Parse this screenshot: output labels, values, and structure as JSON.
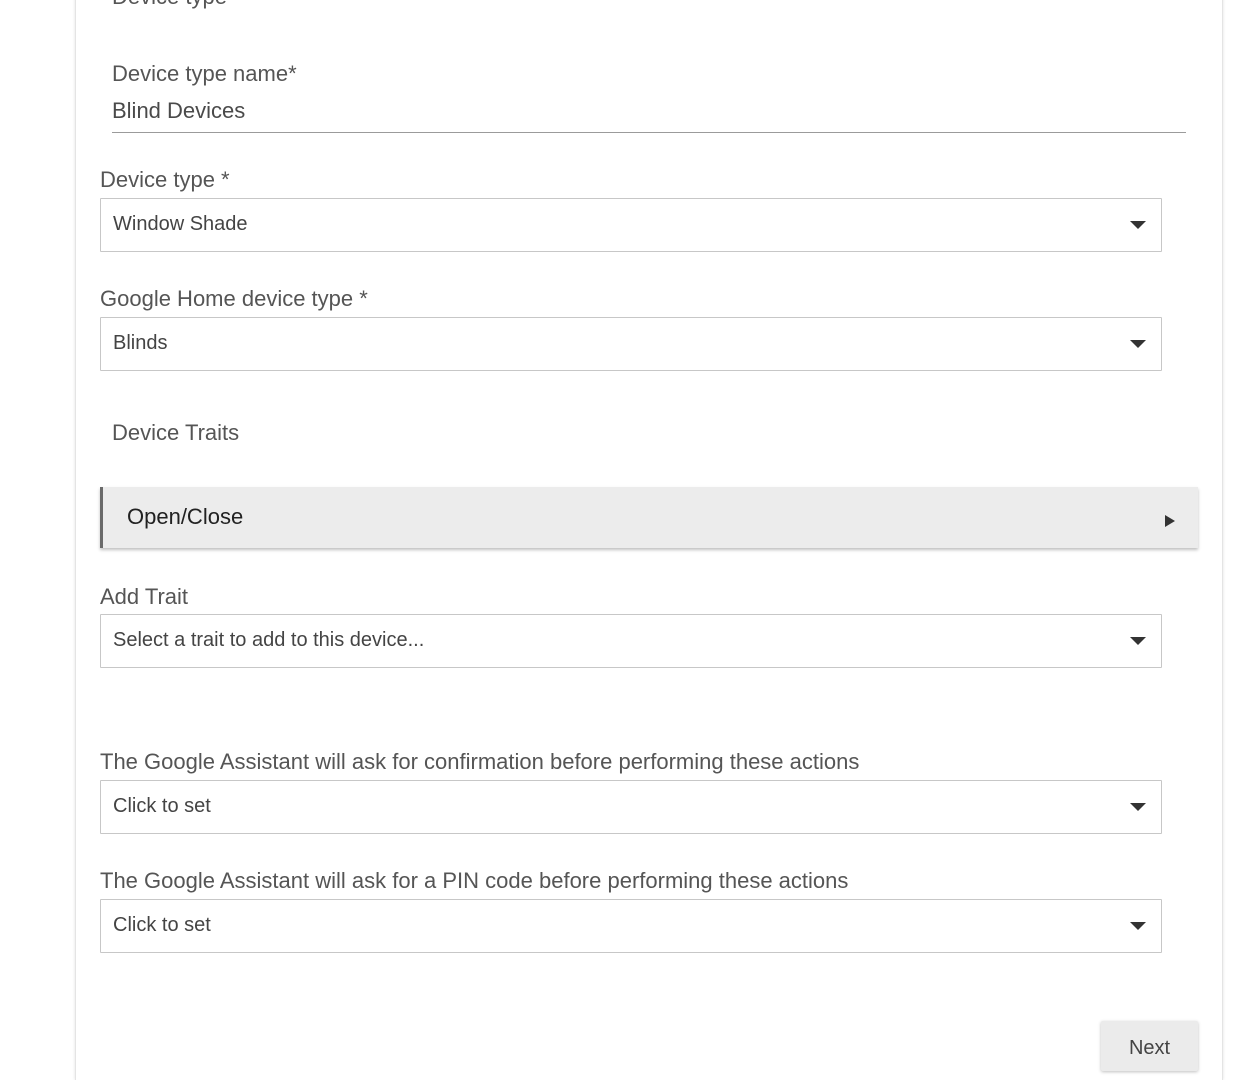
{
  "form": {
    "section_heading_partial": "Device type",
    "device_type_name": {
      "label": "Device type name*",
      "value": "Blind Devices"
    },
    "device_type": {
      "label": "Device type *",
      "selected": "Window Shade"
    },
    "google_home_device_type": {
      "label": "Google Home device type *",
      "selected": "Blinds"
    },
    "device_traits": {
      "title": "Device Traits",
      "items": [
        {
          "name": "Open/Close"
        }
      ]
    },
    "add_trait": {
      "label": "Add Trait",
      "placeholder": "Select a trait to add to this device..."
    },
    "confirmation": {
      "label": "The Google Assistant will ask for confirmation before performing these actions",
      "selected": "Click to set"
    },
    "pin_code": {
      "label": "The Google Assistant will ask for a PIN code before performing these actions",
      "selected": "Click to set"
    },
    "next_label": "Next"
  },
  "icons": {
    "dropdown": "chevron-down-icon",
    "expand": "triangle-right-icon"
  }
}
